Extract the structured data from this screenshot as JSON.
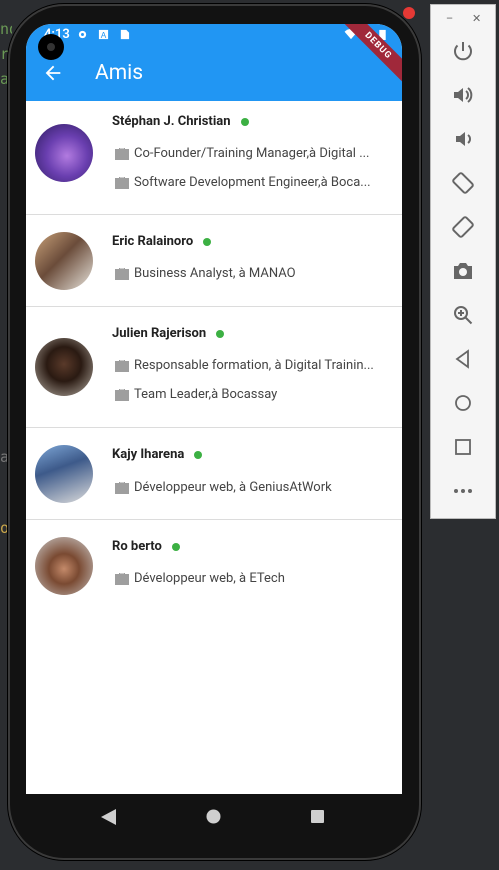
{
  "editor": {
    "fragments": [
      "nd",
      "r",
      "a",
      "a",
      "o"
    ]
  },
  "status_bar": {
    "time": "4:13",
    "debug_banner": "DEBUG"
  },
  "app_bar": {
    "title": "Amis",
    "back_icon": "arrow-back-icon",
    "color": "#2196f3"
  },
  "friends": [
    {
      "name": "Stéphan J. Christian",
      "online": true,
      "jobs": [
        "Co-Founder/Training Manager,à Digital ...",
        "Software Development Engineer,à Boca..."
      ]
    },
    {
      "name": "Eric Ralainoro",
      "online": true,
      "jobs": [
        "Business Analyst, à MANAO"
      ]
    },
    {
      "name": "Julien Rajerison",
      "online": true,
      "jobs": [
        "Responsable formation, à Digital Trainin...",
        "Team Leader,à Bocassay"
      ]
    },
    {
      "name": "Kajy Iharena",
      "online": true,
      "jobs": [
        "Développeur web, à GeniusAtWork"
      ]
    },
    {
      "name": "Ro berto",
      "online": true,
      "jobs": [
        "Développeur web, à ETech"
      ]
    }
  ],
  "nav": {
    "back": "nav-back-icon",
    "home": "nav-home-icon",
    "recents": "nav-recents-icon"
  },
  "emulator_panel": {
    "window_controls": [
      "–",
      "✕"
    ],
    "buttons": [
      "power-icon",
      "volume-up-icon",
      "volume-down-icon",
      "rotate-left-icon",
      "rotate-right-icon",
      "camera-icon",
      "zoom-icon",
      "back-icon",
      "home-icon",
      "overview-icon",
      "more-icon"
    ]
  },
  "online_color": "#3cb043"
}
